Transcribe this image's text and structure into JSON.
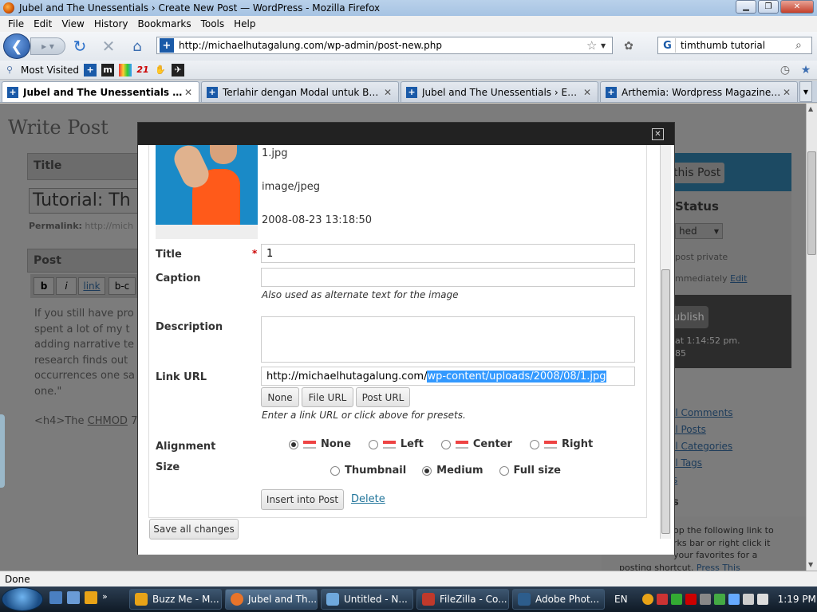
{
  "window": {
    "title": "Jubel and The Unessentials › Create New Post — WordPress - Mozilla Firefox"
  },
  "menu": [
    "File",
    "Edit",
    "View",
    "History",
    "Bookmarks",
    "Tools",
    "Help"
  ],
  "nav": {
    "url": "http://michaelhutagalung.com/wp-admin/post-new.php",
    "search_value": "timthumb tutorial"
  },
  "bookmarks": {
    "most_visited": "Most Visited"
  },
  "tabs": [
    {
      "label": "Jubel and The Unessentials › Crea...",
      "active": true
    },
    {
      "label": "Terlahir dengan Modal untuk Bang...",
      "active": false
    },
    {
      "label": "Jubel and The Unessentials › Edit Co...",
      "active": false
    },
    {
      "label": "Arthemia: Wordpress Magazine The...",
      "active": false
    }
  ],
  "background": {
    "heading": "Write Post",
    "title_label": "Title",
    "title_value": "Tutorial: Th",
    "permalink_label": "Permalink:",
    "permalink_value": "http://mich",
    "post_label": "Post",
    "editor_buttons": [
      "b",
      "i",
      "link",
      "b-c"
    ],
    "body_lines": [
      "If you still have pro",
      "spent a lot of my t",
      "adding narrative te",
      "research finds out",
      "occurrences one sa",
      "one.\""
    ],
    "body_h4_prefix": "<h4>The",
    "body_h4_link": "CHMOD",
    "body_h4_suffix": "7",
    "side": {
      "button": "this Post",
      "status_heading": "Status",
      "status_select": "hed",
      "private_text": "post private",
      "immediately": "mmediately",
      "edit_link": "Edit",
      "publish": "ublish",
      "time_line1": "at 1:14:52 pm.",
      "time_line2": "85",
      "links": [
        "ll Comments",
        "ll Posts",
        "ll Categories",
        "ll Tags",
        "s"
      ],
      "bookmarklet_lines": [
        "op the following link to",
        "rks bar or right click it",
        "your favorites for a",
        "posting shortcut."
      ],
      "press_this": "Press This"
    }
  },
  "media": {
    "filename": "1.jpg",
    "mime": "image/jpeg",
    "date": "2008-08-23 13:18:50",
    "title_label": "Title",
    "required_mark": "*",
    "title_value": "1",
    "caption_label": "Caption",
    "caption_value": "",
    "caption_hint": "Also used as alternate text for the image",
    "description_label": "Description",
    "description_value": "",
    "link_url_label": "Link URL",
    "link_url_prefix": "http://michaelhutagalung.com/",
    "link_url_selected": "wp-content/uploads/2008/08/1.jpg",
    "link_buttons": [
      "None",
      "File URL",
      "Post URL"
    ],
    "link_hint": "Enter a link URL or click above for presets.",
    "alignment_label": "Alignment",
    "alignment_options": [
      {
        "label": "None",
        "selected": true
      },
      {
        "label": "Left",
        "selected": false
      },
      {
        "label": "Center",
        "selected": false
      },
      {
        "label": "Right",
        "selected": false
      }
    ],
    "size_label": "Size",
    "size_options": [
      {
        "label": "Thumbnail",
        "selected": false
      },
      {
        "label": "Medium",
        "selected": true
      },
      {
        "label": "Full size",
        "selected": false
      }
    ],
    "insert_button": "Insert into Post",
    "delete_link": "Delete",
    "save_all_button": "Save all changes"
  },
  "status": {
    "text": "Done"
  },
  "taskbar": {
    "buttons": [
      {
        "label": "Buzz Me - M...",
        "color": "#e8a317",
        "active": false
      },
      {
        "label": "Jubel and Th...",
        "color": "#e8742a",
        "active": true
      },
      {
        "label": "Untitled - N...",
        "color": "#6fa8dc",
        "active": false
      },
      {
        "label": "FileZilla - Co...",
        "color": "#c0392b",
        "active": false
      },
      {
        "label": "Adobe Phot...",
        "color": "#2d5d8c",
        "active": false
      }
    ],
    "lang": "EN",
    "clock": "1:19 PM"
  },
  "colors": {
    "wp_link": "#21759b",
    "selection": "#3399ff",
    "modal_header": "#222222"
  }
}
